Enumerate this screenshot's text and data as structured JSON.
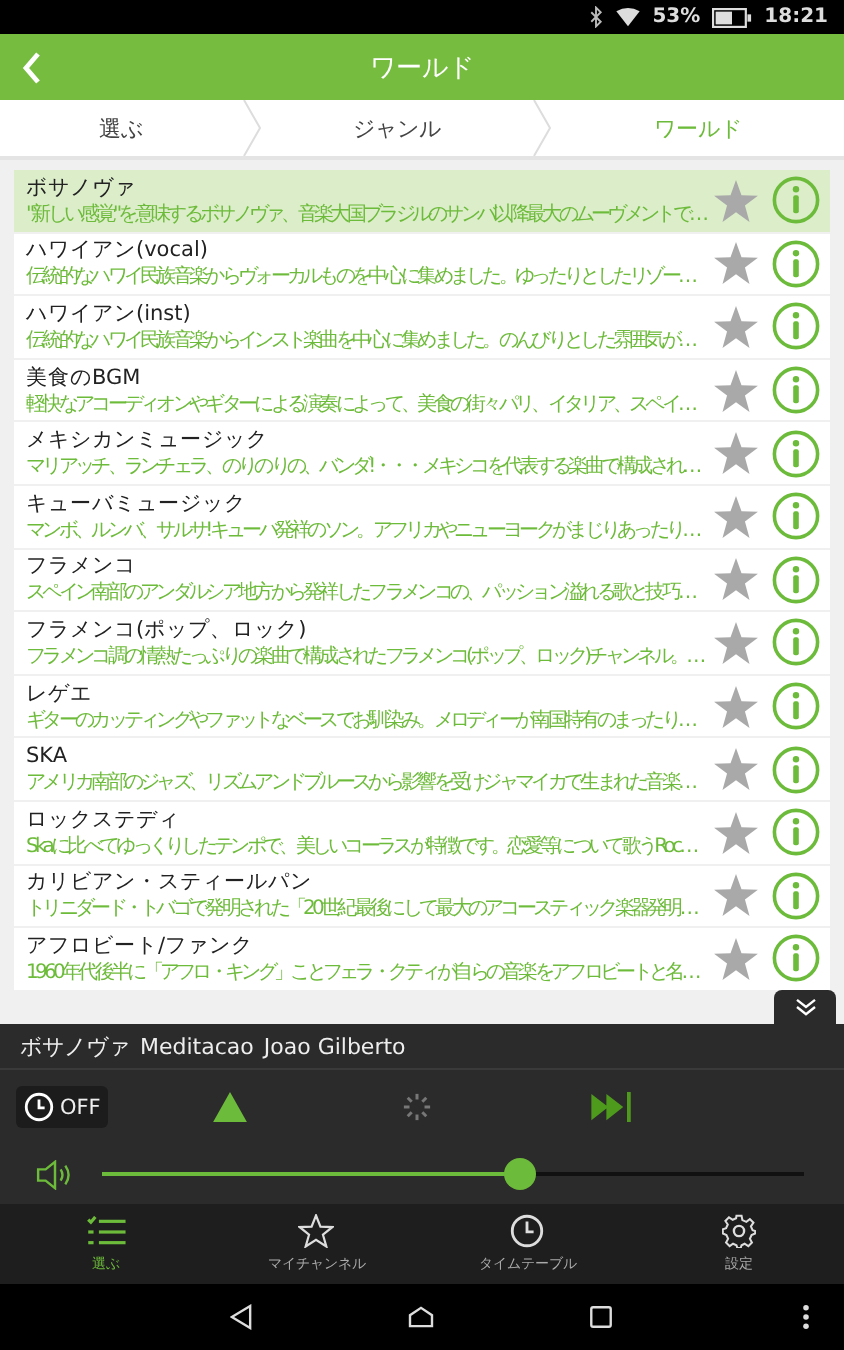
{
  "status_bar": {
    "battery": "53%",
    "time": "18:21"
  },
  "header": {
    "title": "ワールド"
  },
  "breadcrumb": [
    {
      "label": "選ぶ",
      "selected": false
    },
    {
      "label": "ジャンル",
      "selected": false
    },
    {
      "label": "ワールド",
      "selected": true
    }
  ],
  "channels": [
    {
      "title": "ボサノヴァ",
      "description": "\"新しい感覚\"を意味するボサノヴァ、音楽大国ブラジルのサンバ以降最大のムーヴメントで…",
      "selected": true,
      "favorite": false
    },
    {
      "title": "ハワイアン(vocal)",
      "description": "伝統的なハワイ民族音楽からヴォーカルものを中心に集めました。ゆったりとしたリゾー…",
      "selected": false,
      "favorite": false
    },
    {
      "title": "ハワイアン(inst)",
      "description": "伝統的なハワイ民族音楽からインスト楽曲を中心に集めました。のんびりとした雰囲気が…",
      "selected": false,
      "favorite": false
    },
    {
      "title": "美食のBGM",
      "description": "軽快なアコーディオンやギターによる演奏によって、美食の街々パリ、イタリア、スペイ…",
      "selected": false,
      "favorite": false
    },
    {
      "title": "メキシカンミュージック",
      "description": "マリアッチ、ランチェラ、のりのりの、バンダ!・・・メキシコを代表する楽曲で構成され…",
      "selected": false,
      "favorite": false
    },
    {
      "title": "キューバミュージック",
      "description": "マンボ、ルンバ、サルサ!キューバ発祥のソン。アフリカやニューヨークがまじりあったり…",
      "selected": false,
      "favorite": false
    },
    {
      "title": "フラメンコ",
      "description": "スペイン南部のアンダルシア地方から発祥したフラメンコの、パッション溢れる歌と技巧…",
      "selected": false,
      "favorite": false
    },
    {
      "title": "フラメンコ(ポップ、ロック)",
      "description": "フラメンコ調の情熱たっぷりの楽曲で構成されたフラメンコ(ポップ、ロック)チャンネル。…",
      "selected": false,
      "favorite": false
    },
    {
      "title": "レゲエ",
      "description": "ギターのカッティングやファットなベースでお馴染み。メロディーが南国特有のまったり…",
      "selected": false,
      "favorite": false
    },
    {
      "title": "SKA",
      "description": "アメリカ南部のジャズ、リズムアンドブルースから影響を受けジャマイカで生まれた音楽…",
      "selected": false,
      "favorite": false
    },
    {
      "title": "ロックステディ",
      "description": "Skaに比べてゆっくりしたテンポで、美しいコーラスが特徴です。恋愛等について歌うRoc…",
      "selected": false,
      "favorite": false
    },
    {
      "title": "カリビアン・スティールパン",
      "description": "トリニダード・トバゴで発明された「20世紀最後にして最大のアコースティック楽器発明…",
      "selected": false,
      "favorite": false
    },
    {
      "title": "アフロビート/ファンク",
      "description": "1960年代後半に「アフロ・キング」ことフェラ・クティが自らの音楽をアフロビートと名…",
      "selected": false,
      "favorite": false
    }
  ],
  "player": {
    "channel": "ボサノヴァ",
    "track": "Meditacao",
    "artist": "Joao Gilberto",
    "timer": "OFF",
    "volume": {
      "level": 0.6
    }
  },
  "bottom_nav": [
    {
      "kind": "list",
      "label": "選ぶ",
      "selected": true
    },
    {
      "kind": "star",
      "label": "マイチャンネル",
      "selected": false
    },
    {
      "kind": "clock",
      "label": "タイムテーブル",
      "selected": false
    },
    {
      "kind": "gear",
      "label": "設定",
      "selected": false
    }
  ]
}
